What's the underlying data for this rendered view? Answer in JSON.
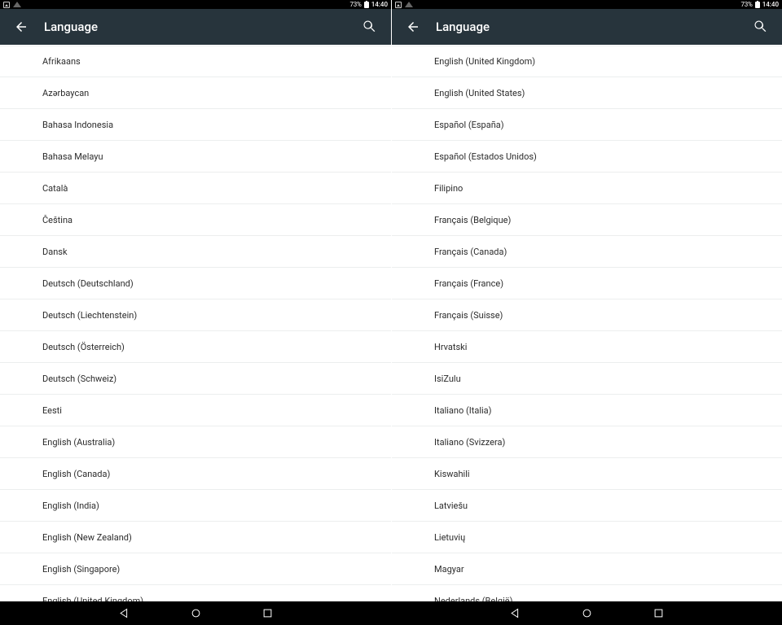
{
  "status": {
    "battery_pct": "73%",
    "clock": "14:40"
  },
  "appbar": {
    "title": "Language"
  },
  "left_items": [
    "Afrikaans",
    "Azərbaycan",
    "Bahasa Indonesia",
    "Bahasa Melayu",
    "Català",
    "Čeština",
    "Dansk",
    "Deutsch (Deutschland)",
    "Deutsch (Liechtenstein)",
    "Deutsch (Österreich)",
    "Deutsch (Schweiz)",
    "Eesti",
    "English (Australia)",
    "English (Canada)",
    "English (India)",
    "English (New Zealand)",
    "English (Singapore)",
    "English (United Kingdom)"
  ],
  "right_items": [
    "English (United Kingdom)",
    "English (United States)",
    "Español (España)",
    "Español (Estados Unidos)",
    "Filipino",
    "Français (Belgique)",
    "Français (Canada)",
    "Français (France)",
    "Français (Suisse)",
    "Hrvatski",
    "IsiZulu",
    "Italiano (Italia)",
    "Italiano (Svizzera)",
    "Kiswahili",
    "Latviešu",
    "Lietuvių",
    "Magyar",
    "Nederlands (België)"
  ]
}
